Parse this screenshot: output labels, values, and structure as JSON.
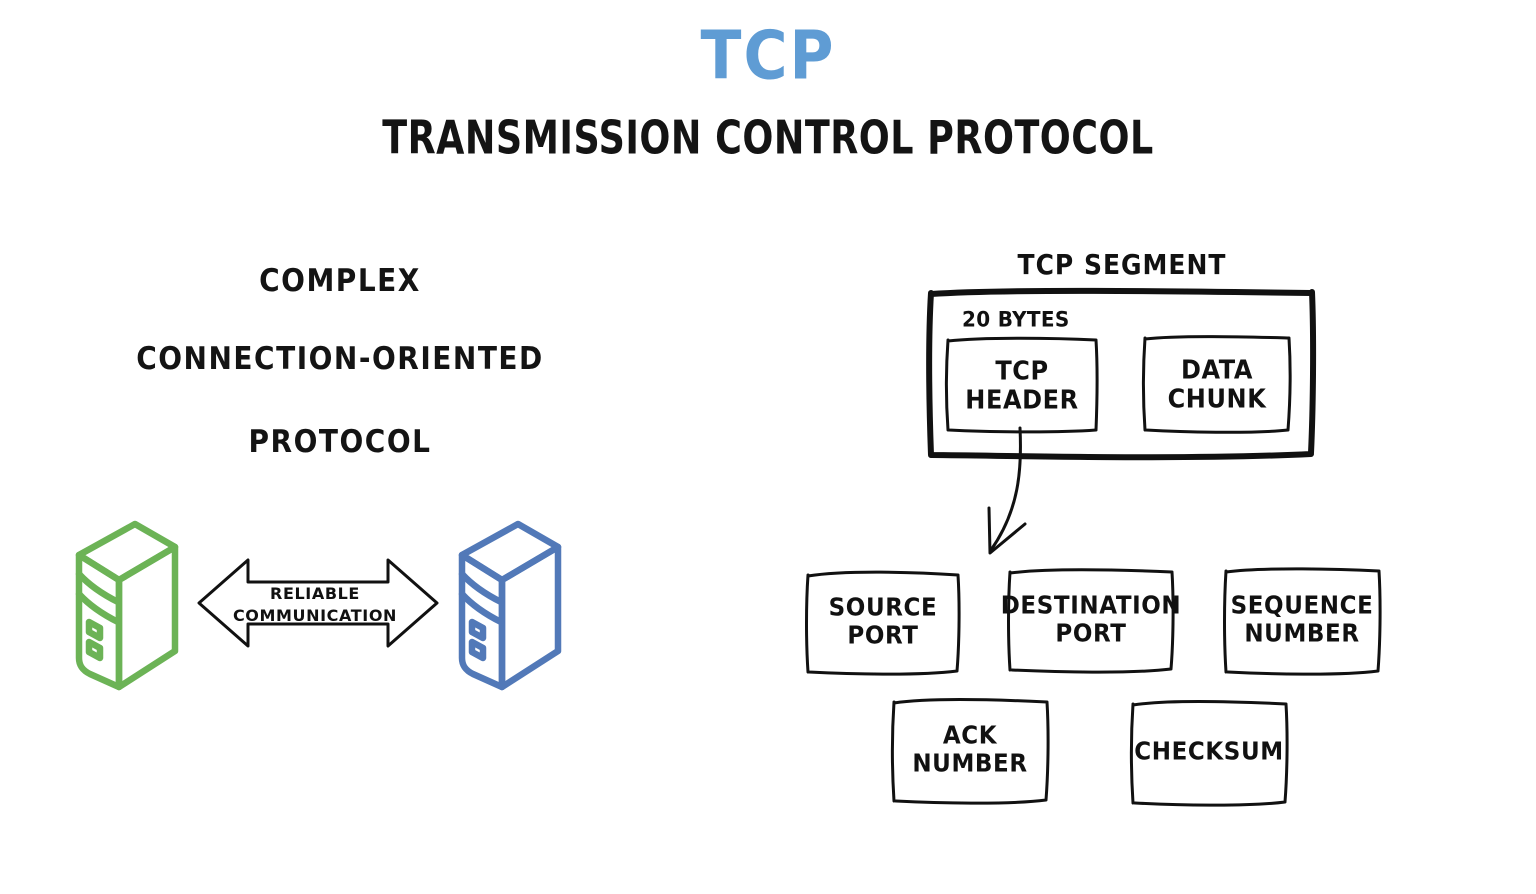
{
  "page": {
    "background": "#ffffff",
    "ink_color": "#111111"
  },
  "header": {
    "title": "TCP",
    "title_color": "#5f9cd4",
    "subtitle": "TRANSMISSION CONTROL PROTOCOL"
  },
  "left_panel": {
    "description_lines": [
      "COMPLEX",
      "CONNECTION-ORIENTED",
      "PROTOCOL"
    ],
    "servers": [
      {
        "name": "left-server",
        "color": "#6cb356"
      },
      {
        "name": "right-server",
        "color": "#5279b8"
      }
    ],
    "arrow": {
      "icon": "double-headed-arrow-icon",
      "label_line_1": "RELIABLE",
      "label_line_2": "COMMUNICATION"
    }
  },
  "right_panel": {
    "segment_title": "TCP SEGMENT",
    "bytes_label": "20 BYTES",
    "segment_parts": [
      {
        "line1": "TCP",
        "line2": "HEADER"
      },
      {
        "line1": "DATA",
        "line2": "CHUNK"
      }
    ],
    "arrow_icon": "curved-down-arrow-icon",
    "header_fields_row1": [
      {
        "line1": "SOURCE",
        "line2": "PORT"
      },
      {
        "line1": "DESTINATION",
        "line2": "PORT"
      },
      {
        "line1": "SEQUENCE",
        "line2": "NUMBER"
      }
    ],
    "header_fields_row2": [
      {
        "line1": "ACK",
        "line2": "NUMBER"
      },
      {
        "line1": "CHECKSUM",
        "line2": ""
      }
    ]
  }
}
